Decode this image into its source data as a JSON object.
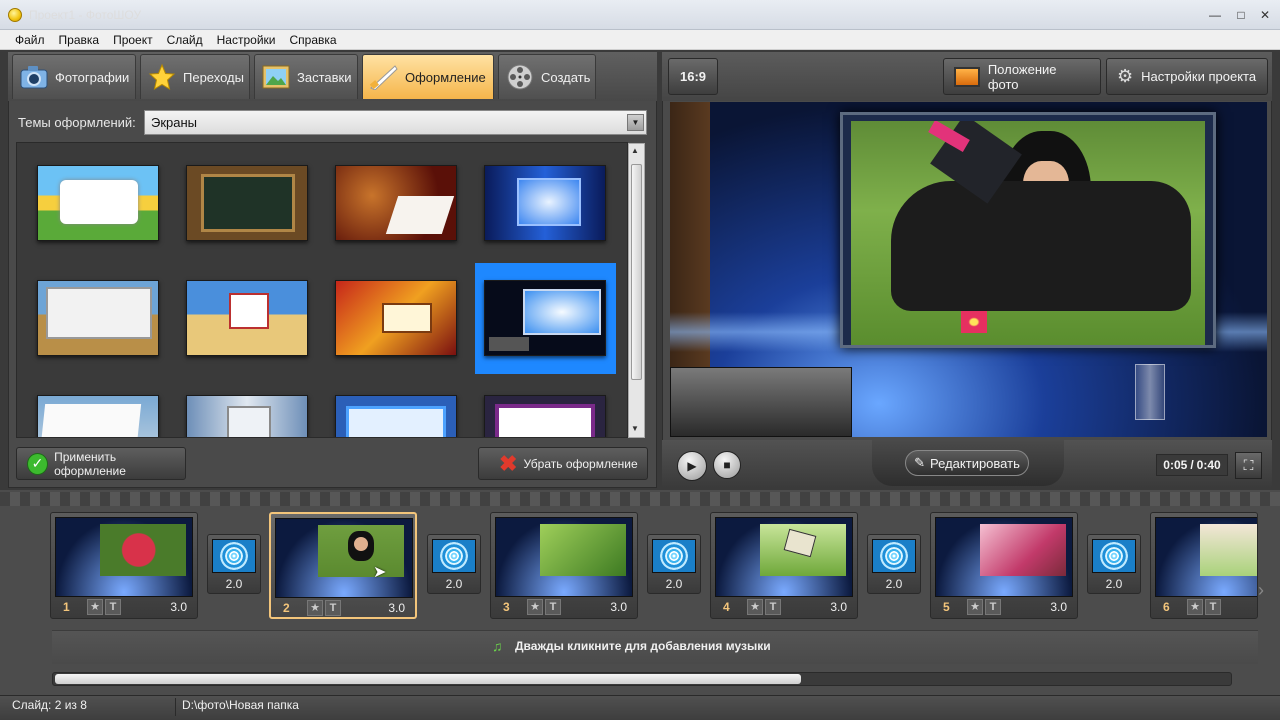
{
  "window": {
    "title": "Проект1 - ФотоШОУ"
  },
  "menu": [
    "Файл",
    "Правка",
    "Проект",
    "Слайд",
    "Настройки",
    "Справка"
  ],
  "tabs": [
    {
      "label": "Фотографии",
      "icon": "camera-icon"
    },
    {
      "label": "Переходы",
      "icon": "star-icon"
    },
    {
      "label": "Заставки",
      "icon": "picture-icon"
    },
    {
      "label": "Оформление",
      "icon": "brush-icon",
      "active": true
    },
    {
      "label": "Создать",
      "icon": "film-reel-icon"
    }
  ],
  "themes": {
    "label": "Темы оформлений:",
    "selected": "Экраны",
    "apply_label": "Применить оформление",
    "remove_label": "Убрать оформление"
  },
  "preview": {
    "aspect": "16:9",
    "photo_position_label": "Положение фото",
    "project_settings_label": "Настройки проекта",
    "edit_label": "Редактировать",
    "time_current": "0:05",
    "time_total": "0:40"
  },
  "timeline": {
    "slides": [
      {
        "num": "1",
        "dur": "3.0",
        "photo": "flower"
      },
      {
        "num": "2",
        "dur": "3.0",
        "photo": "woman",
        "active": true
      },
      {
        "num": "3",
        "dur": "3.0",
        "photo": "caterpillar"
      },
      {
        "num": "4",
        "dur": "3.0",
        "photo": "butterfly"
      },
      {
        "num": "5",
        "dur": "3.0",
        "photo": "pink"
      },
      {
        "num": "6",
        "dur": "",
        "photo": "child"
      }
    ],
    "transitions": [
      "2.0",
      "2.0",
      "2.0",
      "2.0",
      "2.0"
    ],
    "music_hint": "Дважды кликните для добавления музыки"
  },
  "status": {
    "slide": "Слайд: 2 из 8",
    "path": "D:\\фото\\Новая папка"
  },
  "colors": {
    "accent": "#f5b54b",
    "selection": "#1e88ff",
    "apply_icon": "#3cba2e",
    "remove_icon": "#e03a2c"
  }
}
